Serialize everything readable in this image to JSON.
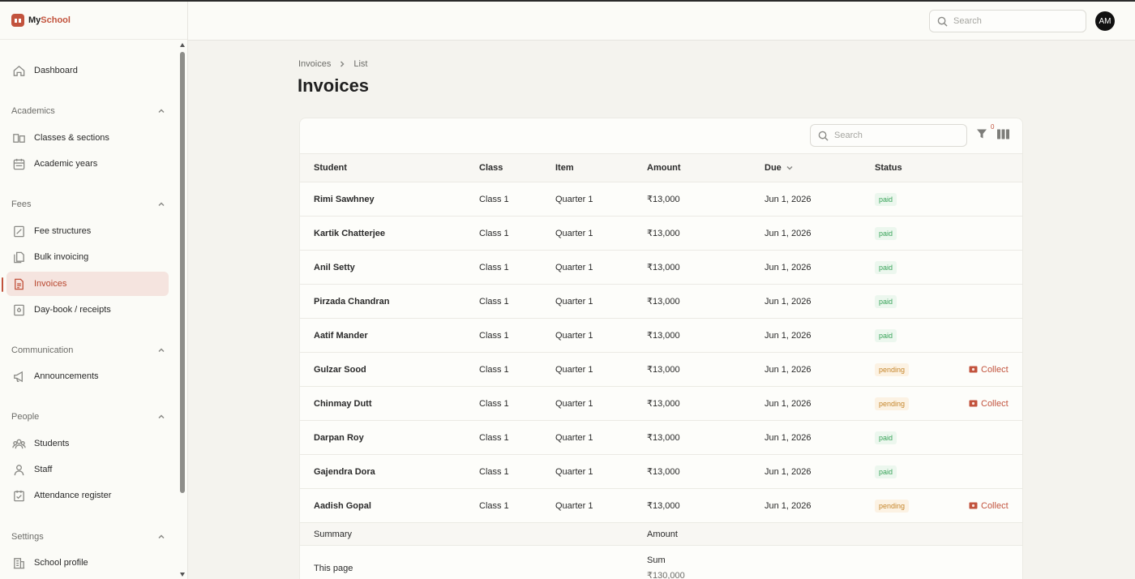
{
  "brand": {
    "name_prefix": "My",
    "name_suffix": "School"
  },
  "sidebar": {
    "top": [
      {
        "label": "Dashboard",
        "icon": "home-icon"
      }
    ],
    "sections": [
      {
        "title": "Academics",
        "items": [
          {
            "label": "Classes & sections",
            "icon": "classes-icon"
          },
          {
            "label": "Academic years",
            "icon": "calendar-icon"
          }
        ]
      },
      {
        "title": "Fees",
        "items": [
          {
            "label": "Fee structures",
            "icon": "fee-structure-icon"
          },
          {
            "label": "Bulk invoicing",
            "icon": "bulk-invoice-icon"
          },
          {
            "label": "Invoices",
            "icon": "invoice-icon",
            "active": true
          },
          {
            "label": "Day-book / receipts",
            "icon": "receipt-icon"
          }
        ]
      },
      {
        "title": "Communication",
        "items": [
          {
            "label": "Announcements",
            "icon": "megaphone-icon"
          }
        ]
      },
      {
        "title": "People",
        "items": [
          {
            "label": "Students",
            "icon": "students-icon"
          },
          {
            "label": "Staff",
            "icon": "staff-icon"
          },
          {
            "label": "Attendance register",
            "icon": "attendance-icon"
          }
        ]
      },
      {
        "title": "Settings",
        "items": [
          {
            "label": "School profile",
            "icon": "building-icon"
          }
        ]
      }
    ]
  },
  "header": {
    "search_placeholder": "Search",
    "avatar_initials": "AM"
  },
  "breadcrumb": {
    "root": "Invoices",
    "current": "List"
  },
  "page_title": "Invoices",
  "table": {
    "search_placeholder": "Search",
    "filter_count": "0",
    "columns": {
      "student": "Student",
      "class": "Class",
      "item": "Item",
      "amount": "Amount",
      "due": "Due",
      "status": "Status"
    },
    "collect_label": "Collect",
    "rows": [
      {
        "student": "Rimi Sawhney",
        "class": "Class 1",
        "item": "Quarter 1",
        "amount": "₹13,000",
        "due": "Jun 1, 2026",
        "status": "paid"
      },
      {
        "student": "Kartik Chatterjee",
        "class": "Class 1",
        "item": "Quarter 1",
        "amount": "₹13,000",
        "due": "Jun 1, 2026",
        "status": "paid"
      },
      {
        "student": "Anil Setty",
        "class": "Class 1",
        "item": "Quarter 1",
        "amount": "₹13,000",
        "due": "Jun 1, 2026",
        "status": "paid"
      },
      {
        "student": "Pirzada Chandran",
        "class": "Class 1",
        "item": "Quarter 1",
        "amount": "₹13,000",
        "due": "Jun 1, 2026",
        "status": "paid"
      },
      {
        "student": "Aatif Mander",
        "class": "Class 1",
        "item": "Quarter 1",
        "amount": "₹13,000",
        "due": "Jun 1, 2026",
        "status": "paid"
      },
      {
        "student": "Gulzar Sood",
        "class": "Class 1",
        "item": "Quarter 1",
        "amount": "₹13,000",
        "due": "Jun 1, 2026",
        "status": "pending"
      },
      {
        "student": "Chinmay Dutt",
        "class": "Class 1",
        "item": "Quarter 1",
        "amount": "₹13,000",
        "due": "Jun 1, 2026",
        "status": "pending"
      },
      {
        "student": "Darpan Roy",
        "class": "Class 1",
        "item": "Quarter 1",
        "amount": "₹13,000",
        "due": "Jun 1, 2026",
        "status": "paid"
      },
      {
        "student": "Gajendra Dora",
        "class": "Class 1",
        "item": "Quarter 1",
        "amount": "₹13,000",
        "due": "Jun 1, 2026",
        "status": "paid"
      },
      {
        "student": "Aadish Gopal",
        "class": "Class 1",
        "item": "Quarter 1",
        "amount": "₹13,000",
        "due": "Jun 1, 2026",
        "status": "pending"
      }
    ],
    "summary": {
      "label": "Summary",
      "amount_header": "Amount",
      "row_label": "This page",
      "sum_label": "Sum",
      "sum_value": "₹130,000"
    }
  },
  "colors": {
    "accent": "#c2533d",
    "paid": "#3aa45a",
    "pending": "#c5862c"
  }
}
